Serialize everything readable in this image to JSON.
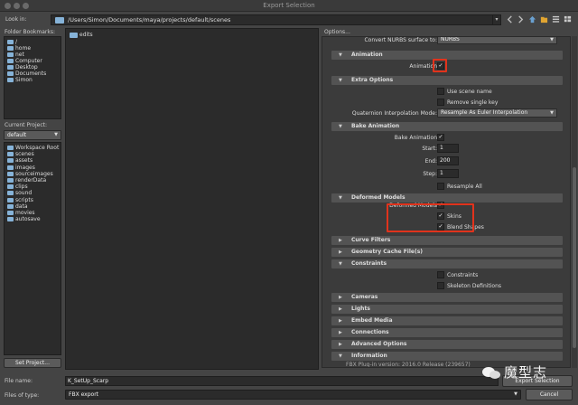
{
  "window": {
    "title": "Export Selection"
  },
  "lookin": {
    "label": "Look in:",
    "path": "/Users/Simon/Documents/maya/projects/default/scenes"
  },
  "bookmarks": {
    "label": "Folder Bookmarks:",
    "items": [
      "/",
      "home",
      "net",
      "Computer",
      "Desktop",
      "Documents",
      "Simon"
    ]
  },
  "current_project": {
    "label": "Current Project:",
    "value": "default",
    "items": [
      "Workspace Root",
      "scenes",
      "assets",
      "images",
      "sourceimages",
      "renderData",
      "clips",
      "sound",
      "scripts",
      "data",
      "movies",
      "autosave"
    ],
    "set_button": "Set Project..."
  },
  "files": {
    "items": [
      "edits"
    ]
  },
  "options": {
    "title": "Options...",
    "partial_top": {
      "label": "Convert NURBS surface to:",
      "value": "NURBS"
    },
    "animation": {
      "header": "Animation",
      "label": "Animation",
      "checked": "✓"
    },
    "extra_options": {
      "header": "Extra Options",
      "use_scene_name": "Use scene name",
      "remove_single_key": "Remove single key",
      "quat_label": "Quaternion Interpolation Mode:",
      "quat_value": "Resample As Euler Interpolation"
    },
    "bake_animation": {
      "header": "Bake Animation",
      "bake_label": "Bake Animation",
      "bake_checked": "✓",
      "start_label": "Start:",
      "start": "1",
      "end_label": "End:",
      "end": "200",
      "step_label": "Step:",
      "step": "1",
      "resample_all": "Resample All"
    },
    "deformed_models": {
      "header": "Deformed Models",
      "label": "Deformed Models",
      "checked": "✓",
      "skins": "Skins",
      "skins_checked": "✓",
      "blend_shapes": "Blend Shapes",
      "blend_checked": "✓"
    },
    "curve_filters": "Curve Filters",
    "geometry_cache": "Geometry Cache File(s)",
    "constraints": {
      "header": "Constraints",
      "constraints": "Constraints",
      "skeleton_definitions": "Skeleton Definitions"
    },
    "cameras": "Cameras",
    "lights": "Lights",
    "embed_media": "Embed Media",
    "connections": "Connections",
    "advanced_options": "Advanced Options",
    "information": "Information",
    "info_partial": "FBX Plug-in version: 2016.0 Release (239657)"
  },
  "bottom": {
    "file_name_label": "File name:",
    "file_name": "K_SetUp_Scarp",
    "files_of_type_label": "Files of type:",
    "files_of_type": "FBX export",
    "export_button": "Export Selection",
    "cancel_button": "Cancel"
  },
  "watermark": {
    "text": "魔型志"
  },
  "colors": {
    "highlight": "#e1331c",
    "folder": "#86b3d8"
  }
}
